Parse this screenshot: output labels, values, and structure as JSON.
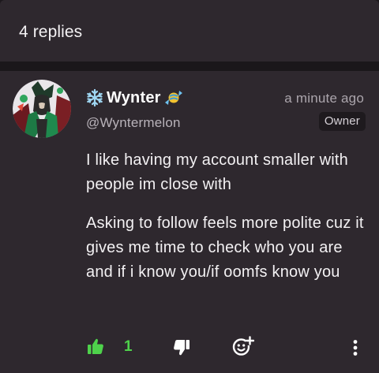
{
  "header": {
    "replies_label": "4 replies"
  },
  "comment": {
    "author": {
      "display_name": "Wynter",
      "handle": "@Wyntermelon",
      "prefix_emoji": "snowflake-icon",
      "suffix_emoji": "candy-icon"
    },
    "timestamp": "a minute ago",
    "badge": "Owner",
    "paragraphs": [
      "I like having my account smaller with people im close with",
      "Asking to follow feels more polite cuz it gives me time to check who you are and if i know you/if oomfs know you"
    ],
    "actions": {
      "likes": "1",
      "like_icon": "thumbs-up-icon",
      "dislike_icon": "thumbs-down-icon",
      "react_icon": "add-reaction-icon",
      "more_icon": "more-vertical-icon"
    }
  },
  "colors": {
    "background": "#1c181c",
    "card": "#2e282e",
    "like_green": "#4ed24b",
    "muted_text": "#aba5ac"
  }
}
